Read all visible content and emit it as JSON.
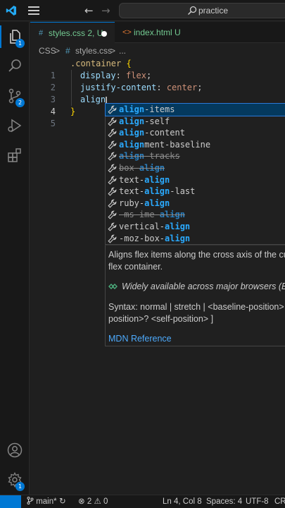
{
  "titlebar": {
    "search_text": "practice",
    "back_icon": "arrow-left-icon",
    "forward_icon": "arrow-right-icon"
  },
  "activity": {
    "explorer_badge": "1",
    "scm_badge": "2",
    "manage_badge": "1"
  },
  "tabs": [
    {
      "icon": "#",
      "label": "styles.css",
      "status": "2, U",
      "dirty": true,
      "active": true
    },
    {
      "icon": "<>",
      "label": "index.html",
      "status": "U",
      "dirty": false,
      "active": false
    }
  ],
  "breadcrumb": [
    "CSS",
    ">",
    "#",
    "styles.css",
    ">",
    "..."
  ],
  "editor": {
    "lines": [
      {
        "num": "1",
        "selector": ".container",
        "brace": "{"
      },
      {
        "num": "2",
        "prop": "display",
        "value": "flex"
      },
      {
        "num": "3",
        "prop": "justify-content",
        "value": "center"
      },
      {
        "num": "4",
        "typed": "align"
      },
      {
        "num": "5",
        "brace": "}"
      }
    ]
  },
  "suggest": {
    "items": [
      {
        "match": "align",
        "rest": "-items",
        "deprecated": false
      },
      {
        "match": "align",
        "rest": "-self",
        "deprecated": false
      },
      {
        "match": "align",
        "rest": "-content",
        "deprecated": false
      },
      {
        "match": "align",
        "rest": "ment-baseline",
        "deprecated": false
      },
      {
        "match": "align",
        "rest": "-tracks",
        "deprecated": true
      },
      {
        "pre": "box-",
        "match": "align",
        "rest": "",
        "deprecated": true
      },
      {
        "pre": "text-",
        "match": "align",
        "rest": "",
        "deprecated": false
      },
      {
        "pre": "text-",
        "match": "align",
        "rest": "-last",
        "deprecated": false
      },
      {
        "pre": "ruby-",
        "match": "align",
        "rest": "",
        "deprecated": false
      },
      {
        "pre": "-ms-ime-",
        "match": "align",
        "rest": "",
        "deprecated": true
      },
      {
        "pre": "vertical-",
        "match": "align",
        "rest": "",
        "deprecated": false
      },
      {
        "pre": "-moz-box-",
        "match": "align",
        "rest": "",
        "deprecated": false
      }
    ]
  },
  "details": {
    "line1": "Aligns flex items along the cross axis of the cur",
    "line2": "flex container.",
    "line3": "Widely available across major browsers (Bas",
    "line4": "Syntax: normal | stretch | <baseline-position> |",
    "line5": "position>? <self-position> ]",
    "link": "MDN Reference"
  },
  "statusbar": {
    "branch": "main*",
    "errors": "2",
    "warnings": "0",
    "position": "Ln 4, Col 8",
    "spaces": "Spaces: 4",
    "encoding": "UTF-8",
    "eol": "CR"
  },
  "colors": {
    "accent": "#0078d4",
    "selector": "#d7ba7d",
    "property": "#9cdcfe",
    "value": "#ce9178",
    "match": "#2aaaff"
  }
}
